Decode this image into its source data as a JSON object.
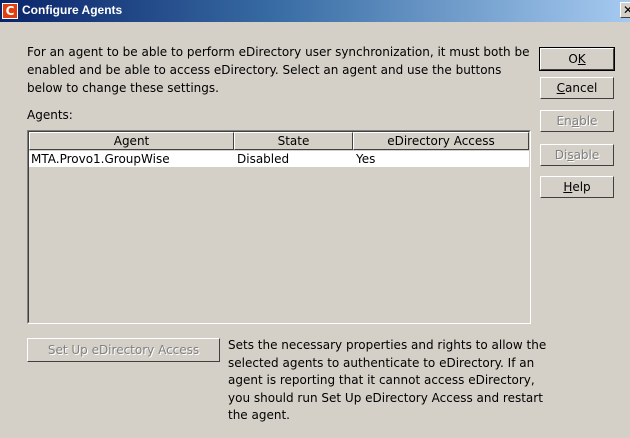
{
  "window": {
    "title": "Configure Agents",
    "close_glyph": "✕"
  },
  "description": "For an agent to be able to perform eDirectory user synchronization, it must both be enabled and be able to access eDirectory. Select an agent and use the buttons below to change these settings.",
  "agents_label": "Agents:",
  "table": {
    "columns": [
      "Agent",
      "State",
      "eDirectory Access"
    ],
    "rows": [
      [
        "MTA.Provo1.GroupWise",
        "Disabled",
        "Yes"
      ]
    ]
  },
  "buttons": {
    "ok": {
      "pre": "O",
      "accel": "K",
      "post": ""
    },
    "cancel": {
      "pre": "",
      "accel": "C",
      "post": "ancel"
    },
    "enable": {
      "pre": "En",
      "accel": "a",
      "post": "ble"
    },
    "disable": {
      "pre": "Di",
      "accel": "s",
      "post": "able"
    },
    "help": {
      "pre": "",
      "accel": "H",
      "post": "elp"
    }
  },
  "setup": {
    "button_label": "Set Up eDirectory Access",
    "description": "Sets the necessary properties and rights to allow the selected agents to authenticate to eDirectory. If an agent is reporting that it cannot access eDirectory, you should run Set Up eDirectory Access and restart the agent."
  },
  "icons": {
    "app": "novell-c-icon",
    "close": "close-icon"
  }
}
